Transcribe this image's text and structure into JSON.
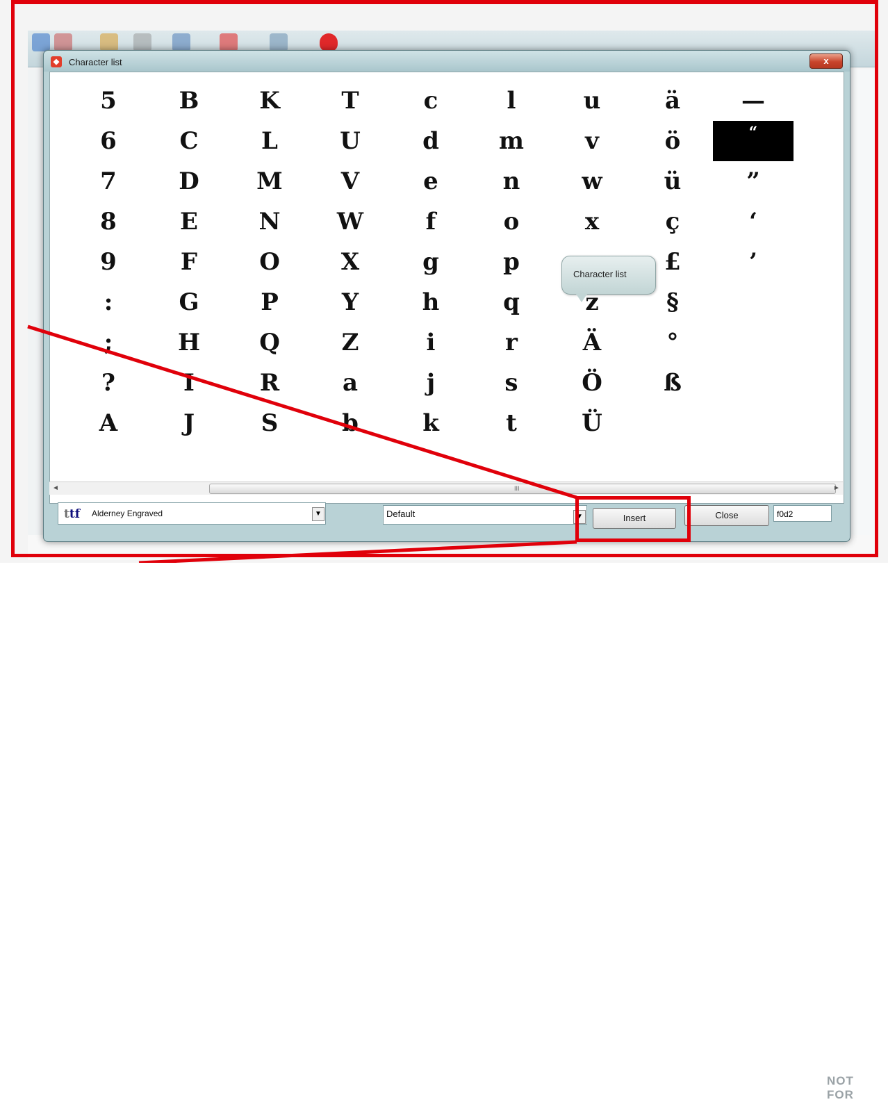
{
  "dialog": {
    "title": "Character list",
    "close_symbol": "x"
  },
  "characters": [
    [
      "5",
      "6",
      "7",
      "8",
      "9",
      ":",
      ";",
      "?",
      "A"
    ],
    [
      "B",
      "C",
      "D",
      "E",
      "F",
      "G",
      "H",
      "I",
      "J"
    ],
    [
      "K",
      "L",
      "M",
      "N",
      "O",
      "P",
      "Q",
      "R",
      "S"
    ],
    [
      "T",
      "U",
      "V",
      "W",
      "X",
      "Y",
      "Z",
      "a",
      "b"
    ],
    [
      "c",
      "d",
      "e",
      "f",
      "g",
      "h",
      "i",
      "j",
      "k"
    ],
    [
      "l",
      "m",
      "n",
      "o",
      "p",
      "q",
      "r",
      "s",
      "t"
    ],
    [
      "u",
      "v",
      "w",
      "x",
      "",
      "z",
      "Ä",
      "Ö",
      "Ü"
    ],
    [
      "ä",
      "ö",
      "ü",
      "ç",
      "£",
      "§",
      "°",
      "ß",
      ""
    ],
    [
      "—",
      "“",
      "”",
      "‘",
      "’",
      "",
      "",
      "",
      ""
    ]
  ],
  "selected_character": "“",
  "scrollbar": {
    "left": "◄",
    "right": "►",
    "grip": "III"
  },
  "bottom": {
    "font_icon": "ttf",
    "font_name": "Alderney Engraved",
    "style": "Default",
    "insert_label": "Insert",
    "close_label": "Close",
    "code_value": "f0d2",
    "dropdown_symbol": "▼"
  },
  "tooltip": {
    "text": "Character list"
  },
  "background": {
    "watermark": "NOT FOR"
  },
  "colors": {
    "annotation": "#e0000a",
    "dialog": "#b9d2d6",
    "selection": "#000000"
  }
}
